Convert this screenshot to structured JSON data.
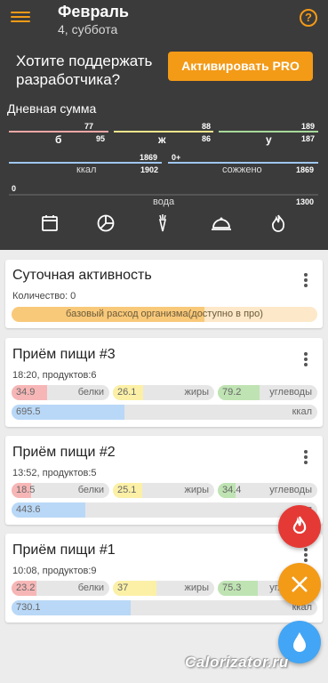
{
  "header": {
    "title": "Февраль",
    "subtitle": "4, суббота",
    "help": "?"
  },
  "promo": {
    "text": "Хотите поддержать разработчика?",
    "button": "Активировать PRO"
  },
  "daily": {
    "title": "Дневная сумма",
    "protein": {
      "label": "б",
      "current": "77",
      "norm": "95"
    },
    "fat": {
      "label": "ж",
      "current": "88",
      "norm": "86"
    },
    "carbs": {
      "label": "у",
      "current": "189",
      "norm": "187"
    },
    "kcal": {
      "label": "ккал",
      "current": "1869",
      "norm": "1902"
    },
    "burned": {
      "label": "сожжено",
      "current": "0+",
      "norm": "1869"
    },
    "water": {
      "label": "вода",
      "current": "0",
      "norm": "1300"
    }
  },
  "toolbar_icons": [
    "calendar-icon",
    "pie-chart-icon",
    "carrot-icon",
    "cloche-icon",
    "flame-icon"
  ],
  "activity": {
    "title": "Суточная активность",
    "sub": "Количество: 0",
    "bar": "базовый расход организма(доступно в про)"
  },
  "meals": [
    {
      "title": "Приём пищи #3",
      "sub": "18:20, продуктов:6",
      "protein": "34.9",
      "fat": "26.1",
      "carbs": "79.2",
      "kcal": "695.5",
      "protein_fill": 0.36,
      "fat_fill": 0.3,
      "carbs_fill": 0.42,
      "kcal_fill": 0.37
    },
    {
      "title": "Приём пищи #2",
      "sub": "13:52, продуктов:5",
      "protein": "18.5",
      "fat": "25.1",
      "carbs": "34.4",
      "kcal": "443.6",
      "protein_fill": 0.2,
      "fat_fill": 0.29,
      "carbs_fill": 0.18,
      "kcal_fill": 0.24
    },
    {
      "title": "Приём пищи #1",
      "sub": "10:08, продуктов:9",
      "protein": "23.2",
      "fat": "37",
      "carbs": "75.3",
      "kcal": "730.1",
      "protein_fill": 0.25,
      "fat_fill": 0.43,
      "carbs_fill": 0.4,
      "kcal_fill": 0.39
    }
  ],
  "labels": {
    "protein": "белки",
    "fat": "жиры",
    "carbs": "углеводы",
    "kcal": "ккал"
  },
  "colors": {
    "accent": "#f39a17",
    "protein": "#f7b6b6",
    "fat": "#fbf0a6",
    "carbs": "#bfe3b3",
    "kcal": "#b9d8f7",
    "fab_burn": "#e53935",
    "fab_meal": "#f39a17",
    "fab_water": "#42a5f5"
  },
  "fabs": [
    "flame-icon",
    "fork-knife-icon",
    "water-drop-icon"
  ],
  "watermark": "Calorizator.ru"
}
